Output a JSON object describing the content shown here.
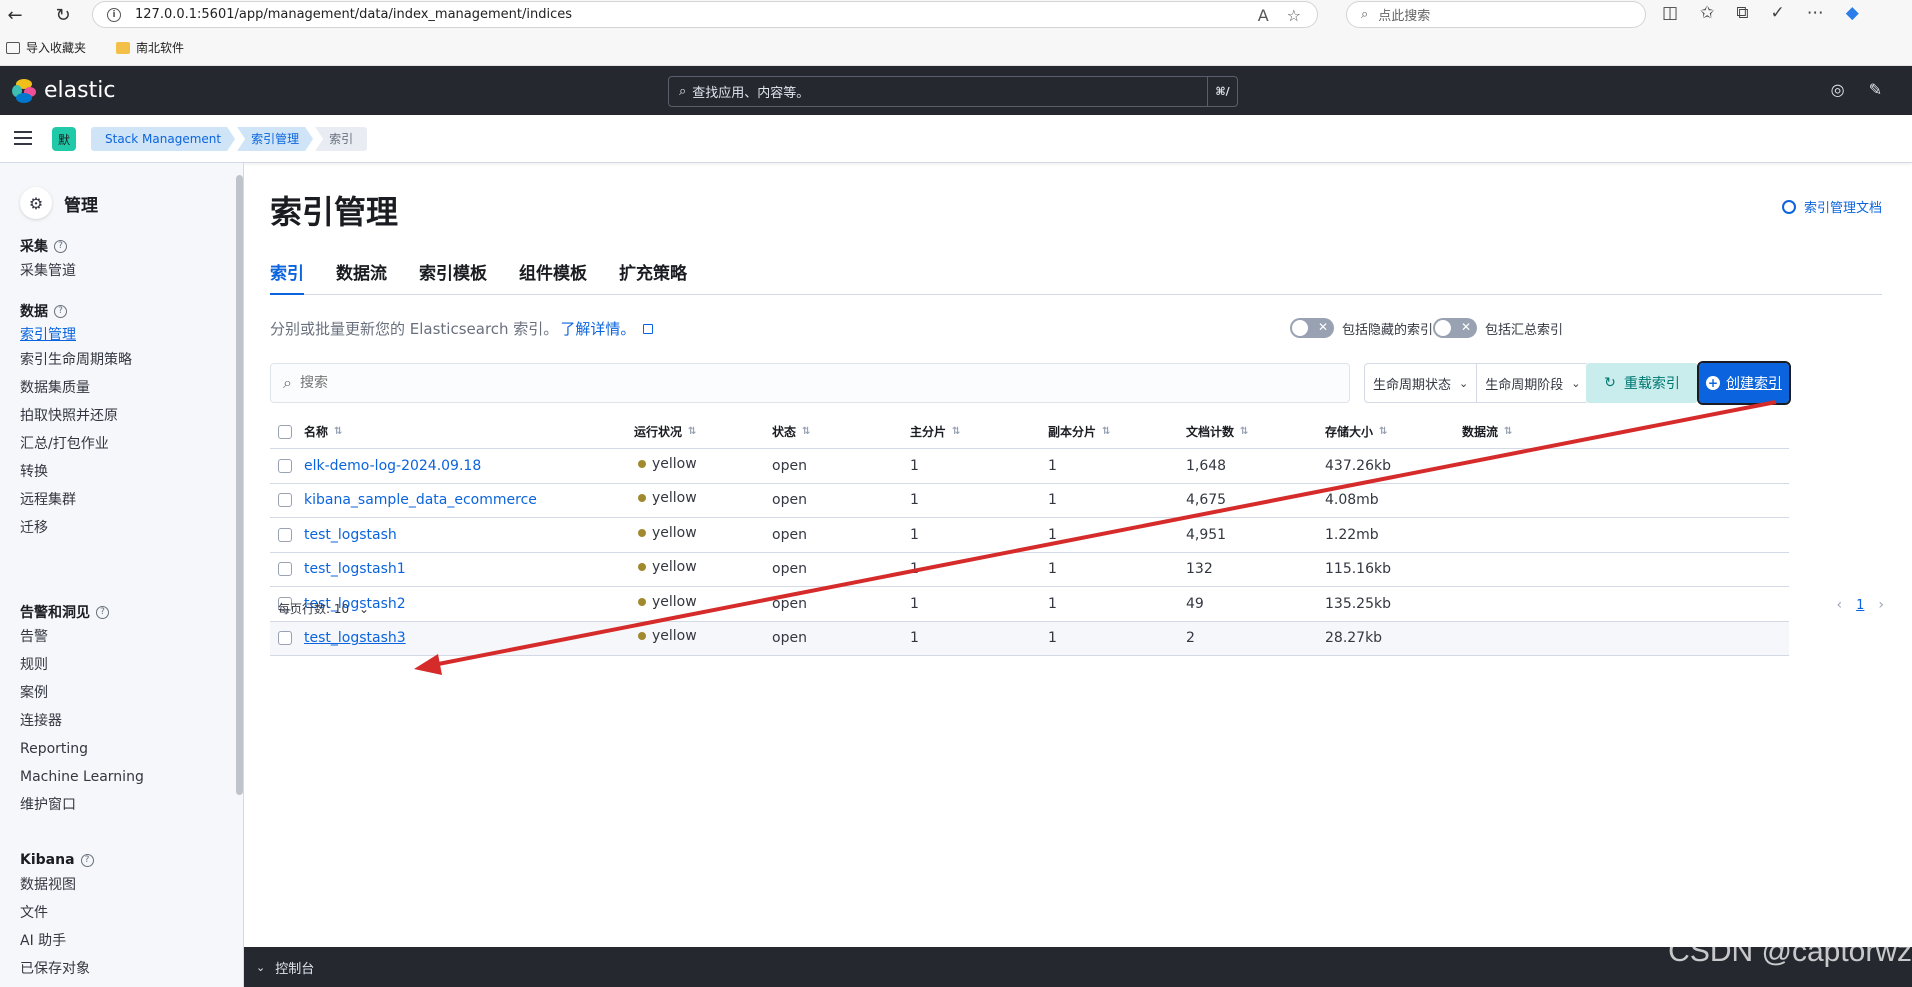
{
  "browser": {
    "url": "127.0.0.1:5601/app/management/data/index_management/indices",
    "search_placeholder": "点此搜索",
    "bookmarks": [
      "导入收藏夹",
      "南北软件"
    ]
  },
  "header": {
    "brand": "elastic",
    "search_placeholder": "查找应用、内容等。",
    "search_shortcut": "⌘/"
  },
  "breadcrumbs": {
    "space_initial": "默",
    "items": [
      "Stack Management",
      "索引管理",
      "索引"
    ]
  },
  "sidebar": {
    "title": "管理",
    "groups": [
      {
        "title": "采集",
        "items": [
          "采集管道"
        ]
      },
      {
        "title": "数据",
        "items": [
          "索引管理",
          "索引生命周期策略",
          "数据集质量",
          "拍取快照并还原",
          "汇总/打包作业",
          "转换",
          "远程集群",
          "迁移"
        ]
      },
      {
        "title": "告警和洞见",
        "items": [
          "告警",
          "规则",
          "案例",
          "连接器",
          "Reporting",
          "Machine Learning",
          "维护窗口"
        ]
      },
      {
        "title": "Kibana",
        "items": [
          "数据视图",
          "文件",
          "AI 助手",
          "已保存对象"
        ]
      }
    ]
  },
  "main": {
    "title": "索引管理",
    "doc_link": "索引管理文档",
    "tabs": [
      "索引",
      "数据流",
      "索引模板",
      "组件模板",
      "扩充策略"
    ],
    "description": "分别或批量更新您的 Elasticsearch 索引。",
    "learn_more": "了解详情。",
    "toggle_hidden": "包括隐藏的索引",
    "toggle_rollup": "包括汇总索引",
    "search_placeholder": "搜索",
    "filter_lifecycle_status": "生命周期状态",
    "filter_lifecycle_phase": "生命周期阶段",
    "reload_button": "重载索引",
    "create_button": "创建索引"
  },
  "table": {
    "columns": [
      "名称",
      "运行状况",
      "状态",
      "主分片",
      "副本分片",
      "文档计数",
      "存储大小",
      "数据流"
    ],
    "rows": [
      {
        "name": "elk-demo-log-2024.09.18",
        "health": "yellow",
        "status": "open",
        "primary": "1",
        "replica": "1",
        "docs": "1,648",
        "size": "437.26kb",
        "stream": ""
      },
      {
        "name": "kibana_sample_data_ecommerce",
        "health": "yellow",
        "status": "open",
        "primary": "1",
        "replica": "1",
        "docs": "4,675",
        "size": "4.08mb",
        "stream": ""
      },
      {
        "name": "test_logstash",
        "health": "yellow",
        "status": "open",
        "primary": "1",
        "replica": "1",
        "docs": "4,951",
        "size": "1.22mb",
        "stream": ""
      },
      {
        "name": "test_logstash1",
        "health": "yellow",
        "status": "open",
        "primary": "1",
        "replica": "1",
        "docs": "132",
        "size": "115.16kb",
        "stream": ""
      },
      {
        "name": "test_logstash2",
        "health": "yellow",
        "status": "open",
        "primary": "1",
        "replica": "1",
        "docs": "49",
        "size": "135.25kb",
        "stream": ""
      },
      {
        "name": "test_logstash3",
        "health": "yellow",
        "status": "open",
        "primary": "1",
        "replica": "1",
        "docs": "2",
        "size": "28.27kb",
        "stream": ""
      }
    ]
  },
  "pagination": {
    "rows_per_page": "每页行数: 10",
    "current_page": "1"
  },
  "console": {
    "label": "控制台"
  },
  "watermark": "CSDN @captorwz",
  "colors": {
    "primary": "#0b64dd",
    "health_yellow": "#a08a2d",
    "annotation_arrow": "#d62b2b"
  }
}
